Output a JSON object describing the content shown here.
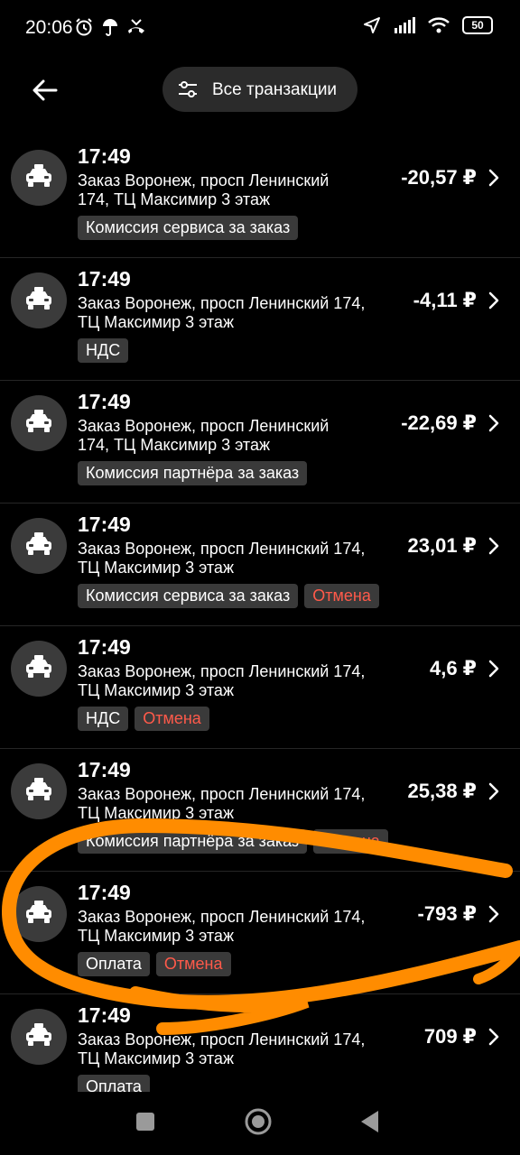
{
  "status_bar": {
    "time": "20:06",
    "battery": "50",
    "icons": [
      "alarm-icon",
      "umbrella-icon",
      "missed-call-icon",
      "location-icon",
      "signal-icon",
      "wifi-icon",
      "battery-icon"
    ]
  },
  "header": {
    "filter_label": "Все транзакции"
  },
  "transactions": [
    {
      "time": "17:49",
      "desc_line1": "Заказ  Воронеж,  просп Ленинский",
      "desc_line2": "174,  ТЦ Максимир 3 этаж",
      "amount": "-20,57 ₽",
      "tags": [
        {
          "text": "Комиссия сервиса за заказ",
          "type": "default"
        }
      ]
    },
    {
      "time": "17:49",
      "desc_line1": "Заказ  Воронеж,  просп Ленинский 174,",
      "desc_line2": "ТЦ Максимир 3 этаж",
      "amount": "-4,11 ₽",
      "tags": [
        {
          "text": "НДС",
          "type": "default"
        }
      ]
    },
    {
      "time": "17:49",
      "desc_line1": "Заказ  Воронеж,  просп Ленинский",
      "desc_line2": "174,  ТЦ Максимир 3 этаж",
      "amount": "-22,69 ₽",
      "tags": [
        {
          "text": "Комиссия партнёра за заказ",
          "type": "default"
        }
      ]
    },
    {
      "time": "17:49",
      "desc_line1": "Заказ  Воронеж,  просп Ленинский 174,",
      "desc_line2": "ТЦ Максимир 3 этаж",
      "amount": "23,01 ₽",
      "tags": [
        {
          "text": "Комиссия сервиса за заказ",
          "type": "default"
        },
        {
          "text": "Отмена",
          "type": "cancel"
        }
      ]
    },
    {
      "time": "17:49",
      "desc_line1": "Заказ  Воронеж,  просп Ленинский 174,",
      "desc_line2": "ТЦ Максимир 3 этаж",
      "amount": "4,6 ₽",
      "tags": [
        {
          "text": "НДС",
          "type": "default"
        },
        {
          "text": "Отмена",
          "type": "cancel"
        }
      ]
    },
    {
      "time": "17:49",
      "desc_line1": "Заказ  Воронеж,  просп Ленинский 174,",
      "desc_line2": "ТЦ Максимир 3 этаж",
      "amount": "25,38 ₽",
      "tags": [
        {
          "text": "Комиссия партнёра за заказ",
          "type": "default"
        },
        {
          "text": "Отмена",
          "type": "cancel"
        }
      ]
    },
    {
      "time": "17:49",
      "desc_line1": "Заказ  Воронеж,  просп Ленинский 174,",
      "desc_line2": "ТЦ Максимир 3 этаж",
      "amount": "-793 ₽",
      "tags": [
        {
          "text": "Оплата",
          "type": "default"
        },
        {
          "text": "Отмена",
          "type": "cancel"
        }
      ]
    },
    {
      "time": "17:49",
      "desc_line1": "Заказ  Воронеж,  просп Ленинский 174,",
      "desc_line2": "ТЦ Максимир 3 этаж",
      "amount": "709 ₽",
      "tags": [
        {
          "text": "Оплата",
          "type": "default"
        }
      ]
    }
  ],
  "nav": {
    "icons": [
      "recents-square-icon",
      "home-circle-icon",
      "back-triangle-icon"
    ]
  },
  "colors": {
    "background": "#000000",
    "chip": "#2b2b2b",
    "avatar": "#3b3b3b",
    "tag": "#3a3a3a",
    "cancel": "#ff5a4a",
    "annotation": "#ff8c00"
  }
}
